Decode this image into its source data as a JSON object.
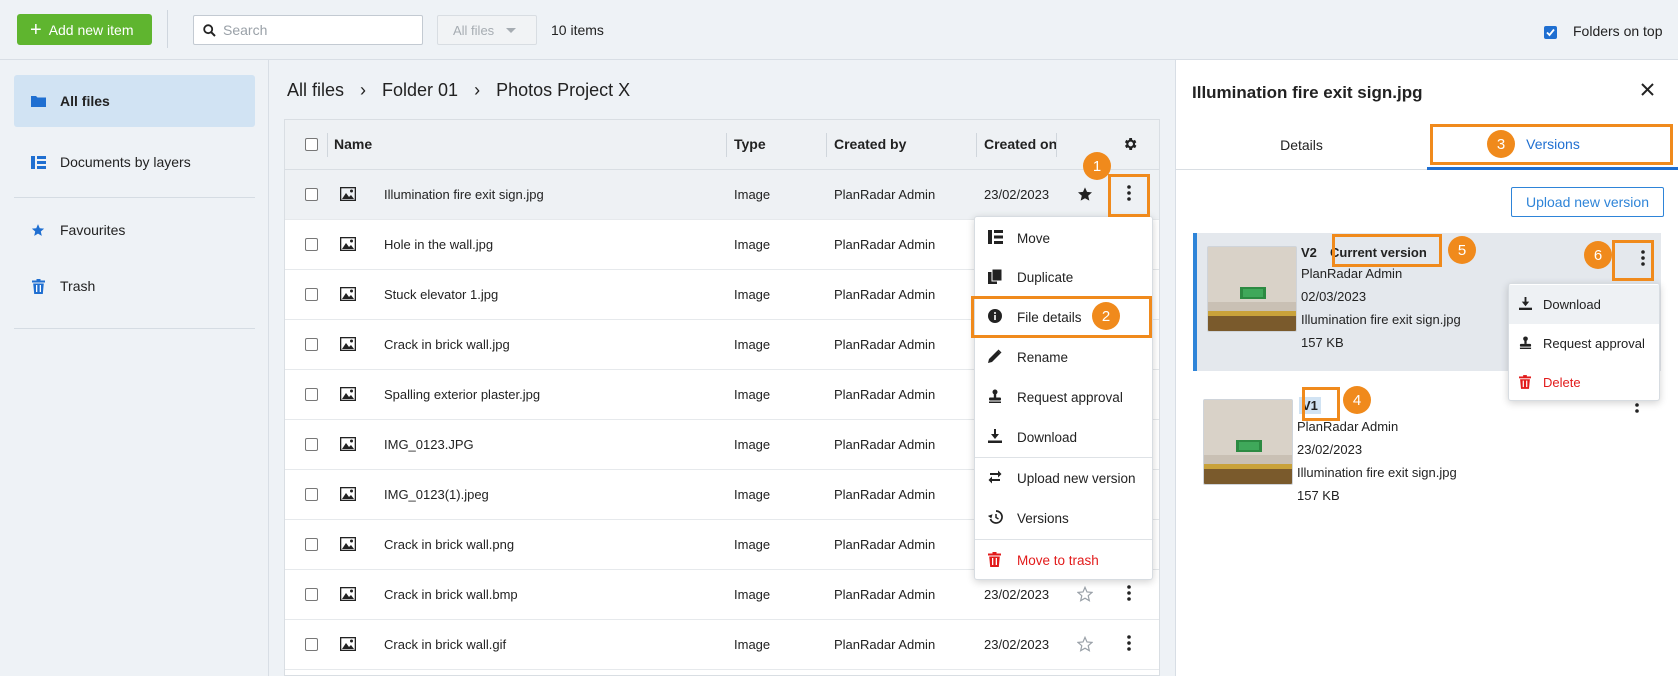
{
  "toolbar": {
    "add_label": "Add new item",
    "search_placeholder": "Search",
    "filter_label": "All files",
    "item_count": "10 items",
    "folders_on_top_label": "Folders on top",
    "folders_on_top_checked": true
  },
  "sidebar": {
    "items": [
      {
        "label": "All files",
        "icon": "folder-icon",
        "active": true
      },
      {
        "label": "Documents by layers",
        "icon": "layers-icon"
      },
      {
        "label": "Favourites",
        "icon": "star-icon"
      },
      {
        "label": "Trash",
        "icon": "trash-icon"
      }
    ]
  },
  "breadcrumb": [
    "All files",
    "Folder 01",
    "Photos Project X"
  ],
  "table": {
    "columns": [
      "Name",
      "Type",
      "Created by",
      "Created on"
    ],
    "rows": [
      {
        "name": "Illumination fire exit sign.jpg",
        "type": "Image",
        "created_by": "PlanRadar Admin",
        "created_on": "23/02/2023",
        "favourite": true
      },
      {
        "name": "Hole in the wall.jpg",
        "type": "Image",
        "created_by": "PlanRadar Admin",
        "created_on": ""
      },
      {
        "name": "Stuck elevator 1.jpg",
        "type": "Image",
        "created_by": "PlanRadar Admin",
        "created_on": ""
      },
      {
        "name": "Crack in brick wall.jpg",
        "type": "Image",
        "created_by": "PlanRadar Admin",
        "created_on": ""
      },
      {
        "name": "Spalling exterior plaster.jpg",
        "type": "Image",
        "created_by": "PlanRadar Admin",
        "created_on": ""
      },
      {
        "name": "IMG_0123.JPG",
        "type": "Image",
        "created_by": "PlanRadar Admin",
        "created_on": ""
      },
      {
        "name": "IMG_0123(1).jpeg",
        "type": "Image",
        "created_by": "PlanRadar Admin",
        "created_on": ""
      },
      {
        "name": "Crack in brick wall.png",
        "type": "Image",
        "created_by": "PlanRadar Admin",
        "created_on": ""
      },
      {
        "name": "Crack in brick wall.bmp",
        "type": "Image",
        "created_by": "PlanRadar Admin",
        "created_on": "23/02/2023",
        "favourite": false
      },
      {
        "name": "Crack in brick wall.gif",
        "type": "Image",
        "created_by": "PlanRadar Admin",
        "created_on": "23/02/2023",
        "favourite": false
      }
    ]
  },
  "context_menu": {
    "items": [
      "Move",
      "Duplicate",
      "File details",
      "Rename",
      "Request approval",
      "Download",
      "Upload new version",
      "Versions",
      "Move to trash"
    ]
  },
  "panel": {
    "title": "Illumination fire exit sign.jpg",
    "tabs": [
      "Details",
      "Versions"
    ],
    "upload_label": "Upload new version",
    "versions": [
      {
        "label": "V2",
        "badge": "Current version",
        "author": "PlanRadar Admin",
        "date": "02/03/2023",
        "file": "Illumination fire exit sign.jpg",
        "size": "157 KB"
      },
      {
        "label": "V1",
        "author": "PlanRadar Admin",
        "date": "23/02/2023",
        "file": "Illumination fire exit sign.jpg",
        "size": "157 KB"
      }
    ],
    "version_menu": [
      "Download",
      "Request approval",
      "Delete"
    ]
  },
  "steps": [
    "1",
    "2",
    "3",
    "4",
    "5",
    "6"
  ],
  "colors": {
    "accent": "#1f6fd1",
    "add_button": "#5fb52f",
    "highlight": "#f08a1c",
    "danger": "#e21b1b"
  }
}
